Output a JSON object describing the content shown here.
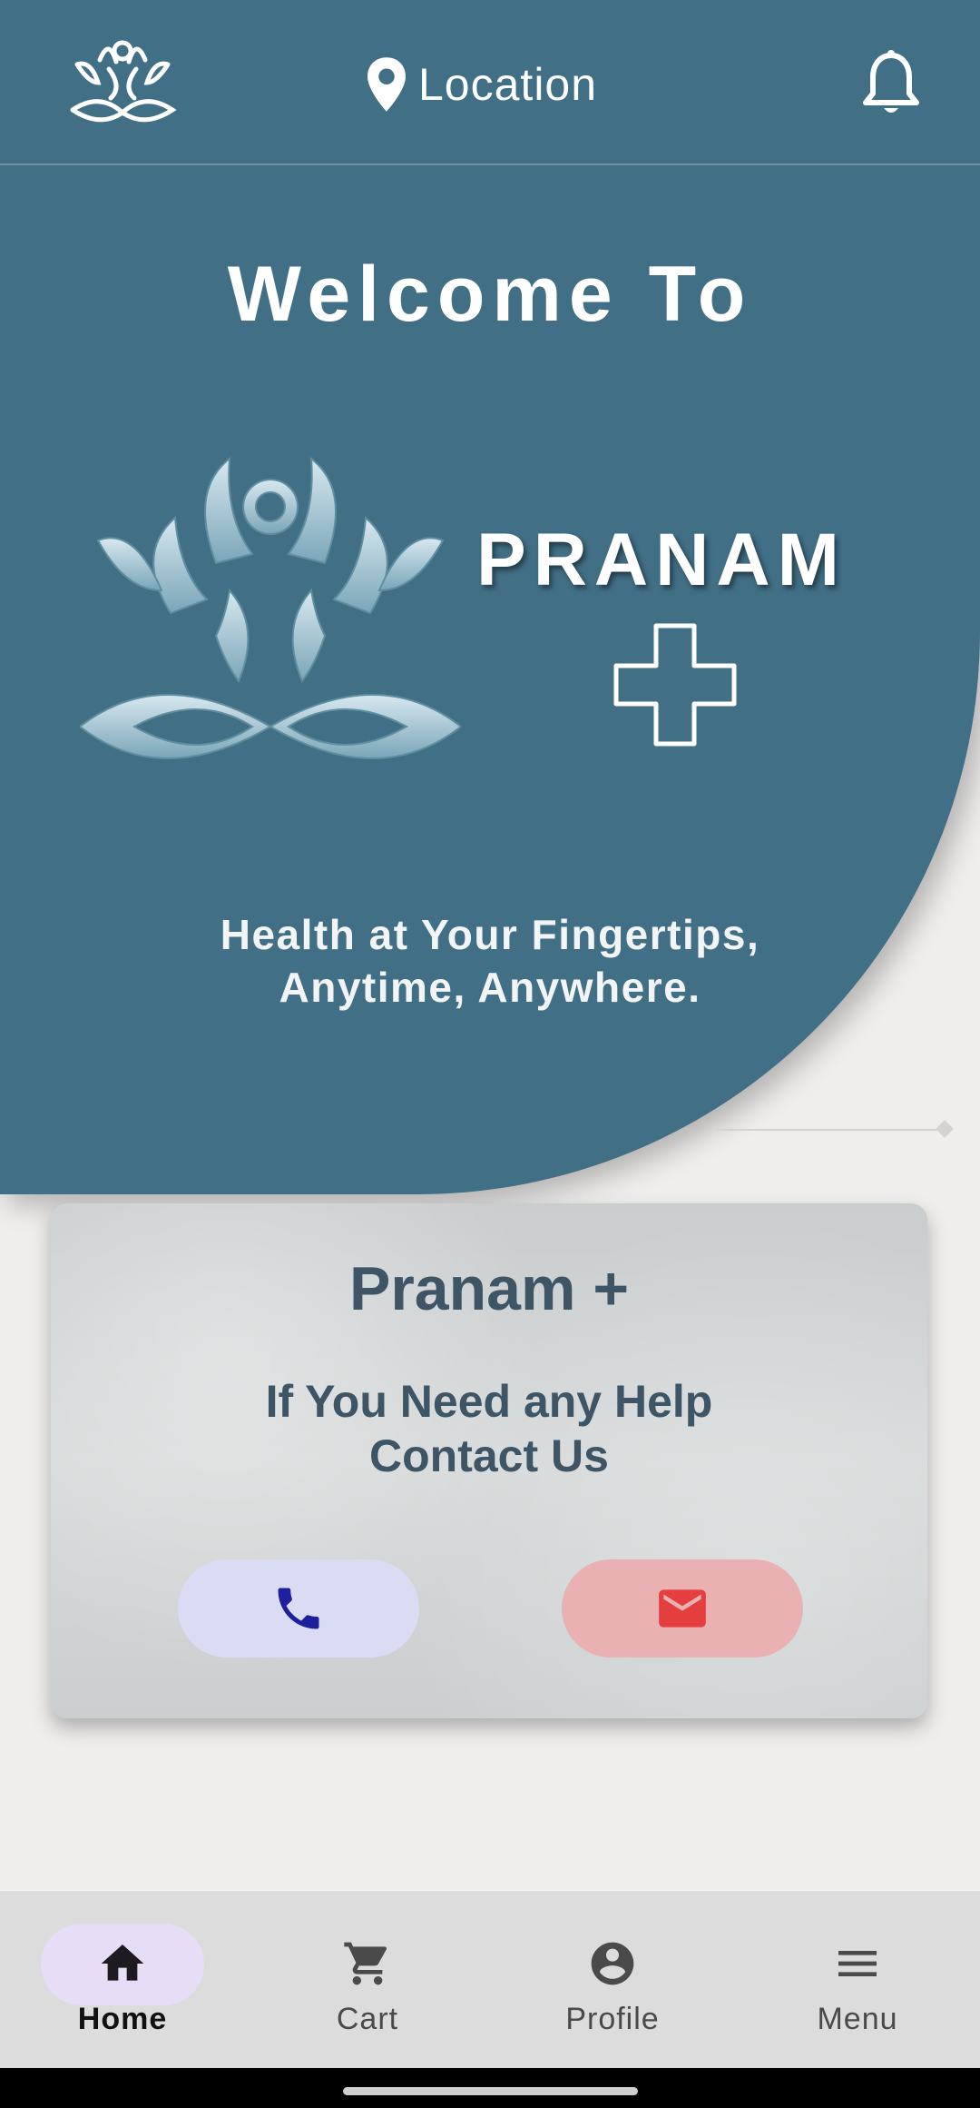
{
  "header": {
    "location_label": "Location"
  },
  "hero": {
    "welcome": "Welcome To",
    "brand_name": "PRANAM",
    "tagline_line1": "Health at Your Fingertips,",
    "tagline_line2": "Anytime, Anywhere."
  },
  "contact_card": {
    "title": "Pranam +",
    "subtitle_line1": "If You Need any Help",
    "subtitle_line2": "Contact Us"
  },
  "bottom_nav": {
    "items": [
      {
        "label": "Home",
        "icon": "home-icon",
        "active": true
      },
      {
        "label": "Cart",
        "icon": "cart-icon",
        "active": false
      },
      {
        "label": "Profile",
        "icon": "profile-icon",
        "active": false
      },
      {
        "label": "Menu",
        "icon": "menu-icon",
        "active": false
      }
    ]
  },
  "colors": {
    "primary": "#416f86",
    "card_text": "#3e5566",
    "call_button_bg": "#dadcf3",
    "call_icon": "#1c1f9e",
    "mail_button_bg": "#e9b1b1",
    "mail_icon": "#e53e3e",
    "nav_active_pill": "#e8ddf6"
  }
}
